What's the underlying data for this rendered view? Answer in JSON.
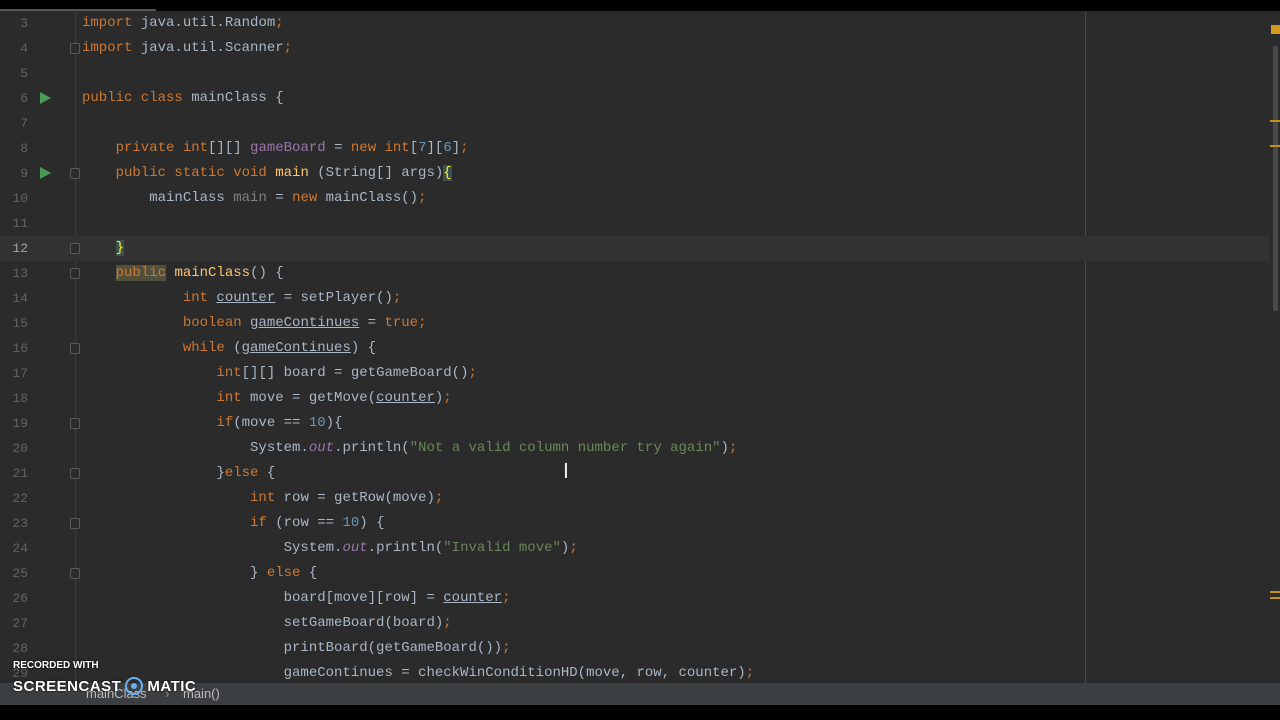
{
  "editor": {
    "current_line": 12,
    "lines": [
      {
        "n": "3",
        "run": false,
        "fold": false,
        "tokens": [
          [
            "import",
            "kw"
          ],
          [
            " java.util.Random",
            ""
          ],
          [
            ";",
            "kw"
          ]
        ]
      },
      {
        "n": "4",
        "run": false,
        "fold": true,
        "tokens": [
          [
            "import",
            "kw"
          ],
          [
            " java.util.Scanner",
            ""
          ],
          [
            ";",
            "kw"
          ]
        ]
      },
      {
        "n": "5",
        "run": false,
        "fold": false,
        "tokens": []
      },
      {
        "n": "6",
        "run": true,
        "fold": false,
        "tokens": [
          [
            "public class ",
            "kw"
          ],
          [
            "mainClass {",
            ""
          ]
        ]
      },
      {
        "n": "7",
        "run": false,
        "fold": false,
        "tokens": []
      },
      {
        "n": "8",
        "run": false,
        "fold": false,
        "tokens": [
          [
            "    private int",
            "kw"
          ],
          [
            "[][] ",
            ""
          ],
          [
            "gameBoard",
            "fd"
          ],
          [
            " = ",
            ""
          ],
          [
            "new int",
            "kw"
          ],
          [
            "[",
            ""
          ],
          [
            "7",
            "num"
          ],
          [
            "][",
            ""
          ],
          [
            "6",
            "num"
          ],
          [
            "]",
            ""
          ],
          [
            ";",
            "kw"
          ]
        ]
      },
      {
        "n": "9",
        "run": true,
        "fold": true,
        "tokens": [
          [
            "    public static void ",
            "kw"
          ],
          [
            "main",
            "md"
          ],
          [
            " (String[] args)",
            ""
          ],
          [
            "{",
            "br"
          ]
        ]
      },
      {
        "n": "10",
        "run": false,
        "fold": false,
        "tokens": [
          [
            "        mainClass ",
            ""
          ],
          [
            "main",
            "un"
          ],
          [
            " = ",
            ""
          ],
          [
            "new ",
            "kw"
          ],
          [
            "mainClass()",
            ""
          ],
          [
            ";",
            "kw"
          ]
        ]
      },
      {
        "n": "11",
        "run": false,
        "fold": false,
        "tokens": []
      },
      {
        "n": "12",
        "run": false,
        "fold": true,
        "tokens": [
          [
            "    ",
            ""
          ],
          [
            "}",
            "br"
          ]
        ]
      },
      {
        "n": "13",
        "run": false,
        "fold": true,
        "tokens": [
          [
            "    ",
            ""
          ],
          [
            "public",
            "kw hl"
          ],
          [
            " ",
            ""
          ],
          [
            "mainClass",
            "md"
          ],
          [
            "() {",
            ""
          ]
        ]
      },
      {
        "n": "14",
        "run": false,
        "fold": false,
        "tokens": [
          [
            "            int ",
            "kw"
          ],
          [
            "counter",
            "ul"
          ],
          [
            " = setPlayer()",
            ""
          ],
          [
            ";",
            "kw"
          ]
        ]
      },
      {
        "n": "15",
        "run": false,
        "fold": false,
        "tokens": [
          [
            "            boolean ",
            "kw"
          ],
          [
            "gameContinues",
            "ul"
          ],
          [
            " = ",
            ""
          ],
          [
            "true",
            "kw"
          ],
          [
            ";",
            "kw"
          ]
        ]
      },
      {
        "n": "16",
        "run": false,
        "fold": true,
        "tokens": [
          [
            "            while ",
            "kw"
          ],
          [
            "(",
            ""
          ],
          [
            "gameContinues",
            "ul"
          ],
          [
            ") {",
            ""
          ]
        ]
      },
      {
        "n": "17",
        "run": false,
        "fold": false,
        "tokens": [
          [
            "                int",
            "kw"
          ],
          [
            "[][] board = getGameBoard()",
            ""
          ],
          [
            ";",
            "kw"
          ]
        ]
      },
      {
        "n": "18",
        "run": false,
        "fold": false,
        "tokens": [
          [
            "                int ",
            "kw"
          ],
          [
            "move = getMove(",
            ""
          ],
          [
            "counter",
            "ul"
          ],
          [
            ")",
            ""
          ],
          [
            ";",
            "kw"
          ]
        ]
      },
      {
        "n": "19",
        "run": false,
        "fold": true,
        "tokens": [
          [
            "                if",
            "kw"
          ],
          [
            "(move == ",
            ""
          ],
          [
            "10",
            "num"
          ],
          [
            "){",
            ""
          ]
        ]
      },
      {
        "n": "20",
        "run": false,
        "fold": false,
        "tokens": [
          [
            "                    System.",
            ""
          ],
          [
            "out",
            "st"
          ],
          [
            ".println(",
            ""
          ],
          [
            "\"Not a valid column number try again\"",
            "str"
          ],
          [
            ")",
            ""
          ],
          [
            ";",
            "kw"
          ]
        ]
      },
      {
        "n": "21",
        "run": false,
        "fold": true,
        "tokens": [
          [
            "                }",
            ""
          ],
          [
            "else ",
            "kw"
          ],
          [
            "{",
            ""
          ]
        ]
      },
      {
        "n": "22",
        "run": false,
        "fold": false,
        "tokens": [
          [
            "                    int ",
            "kw"
          ],
          [
            "row = getRow(move)",
            ""
          ],
          [
            ";",
            "kw"
          ]
        ]
      },
      {
        "n": "23",
        "run": false,
        "fold": true,
        "tokens": [
          [
            "                    if ",
            "kw"
          ],
          [
            "(row == ",
            ""
          ],
          [
            "10",
            "num"
          ],
          [
            ") {",
            ""
          ]
        ]
      },
      {
        "n": "24",
        "run": false,
        "fold": false,
        "tokens": [
          [
            "                        System.",
            ""
          ],
          [
            "out",
            "st"
          ],
          [
            ".println(",
            ""
          ],
          [
            "\"Invalid move\"",
            "str"
          ],
          [
            ")",
            ""
          ],
          [
            ";",
            "kw"
          ]
        ]
      },
      {
        "n": "25",
        "run": false,
        "fold": true,
        "tokens": [
          [
            "                    } ",
            ""
          ],
          [
            "else ",
            "kw"
          ],
          [
            "{",
            ""
          ]
        ]
      },
      {
        "n": "26",
        "run": false,
        "fold": false,
        "tokens": [
          [
            "                        board[move][row] = ",
            ""
          ],
          [
            "counter",
            "ul"
          ],
          [
            ";",
            "kw"
          ]
        ]
      },
      {
        "n": "27",
        "run": false,
        "fold": false,
        "tokens": [
          [
            "                        setGameBoard(board)",
            ""
          ],
          [
            ";",
            "kw"
          ]
        ]
      },
      {
        "n": "28",
        "run": false,
        "fold": false,
        "tokens": [
          [
            "                        printBoard(getGameBoard())",
            ""
          ],
          [
            ";",
            "kw"
          ]
        ]
      },
      {
        "n": "29",
        "run": false,
        "fold": false,
        "tokens": [
          [
            "                        gameContinues = checkWinConditionHD(move, row, counter)",
            ""
          ],
          [
            ";",
            "kw"
          ]
        ]
      }
    ]
  },
  "breadcrumb": {
    "class_name": "mainClass",
    "separator": "›",
    "method": "main()"
  },
  "watermark": {
    "top": "RECORDED WITH",
    "left": "SCREENCAST",
    "right": "MATIC"
  },
  "colors": {
    "background": "#2b2b2b",
    "keyword": "#cc7832",
    "string": "#6a8759",
    "number": "#6897bb",
    "field": "#9876aa",
    "method": "#ffc66d"
  }
}
